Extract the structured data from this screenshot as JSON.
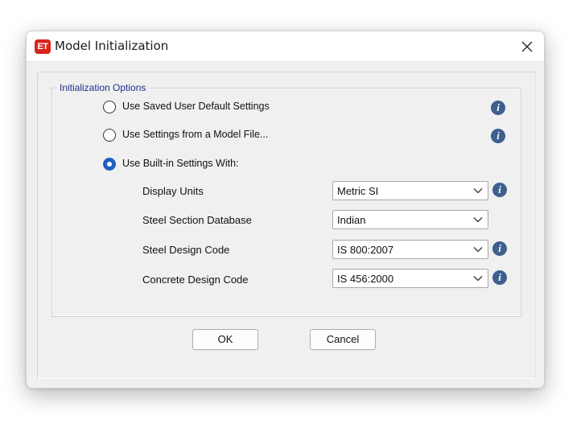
{
  "window": {
    "title": "Model Initialization",
    "app_icon_text": "ET"
  },
  "group": {
    "legend": "Initialization Options"
  },
  "options": [
    {
      "label": "Use Saved User Default Settings",
      "selected": false
    },
    {
      "label": "Use Settings from a Model File...",
      "selected": false
    },
    {
      "label": "Use Built-in Settings With:",
      "selected": true
    }
  ],
  "settings": {
    "display_units": {
      "label": "Display Units",
      "value": "Metric SI"
    },
    "steel_section_database": {
      "label": "Steel Section Database",
      "value": "Indian"
    },
    "steel_design_code": {
      "label": "Steel Design Code",
      "value": "IS 800:2007"
    },
    "concrete_design_code": {
      "label": "Concrete Design Code",
      "value": "IS 456:2000"
    }
  },
  "buttons": {
    "ok": "OK",
    "cancel": "Cancel"
  },
  "icons": {
    "info_glyph": "i"
  },
  "colors": {
    "app_icon_bg": "#d9241c",
    "legend_text": "#1c2f8a",
    "radio_selected": "#1f5fbf",
    "info_icon_bg": "#3f5f8f"
  }
}
